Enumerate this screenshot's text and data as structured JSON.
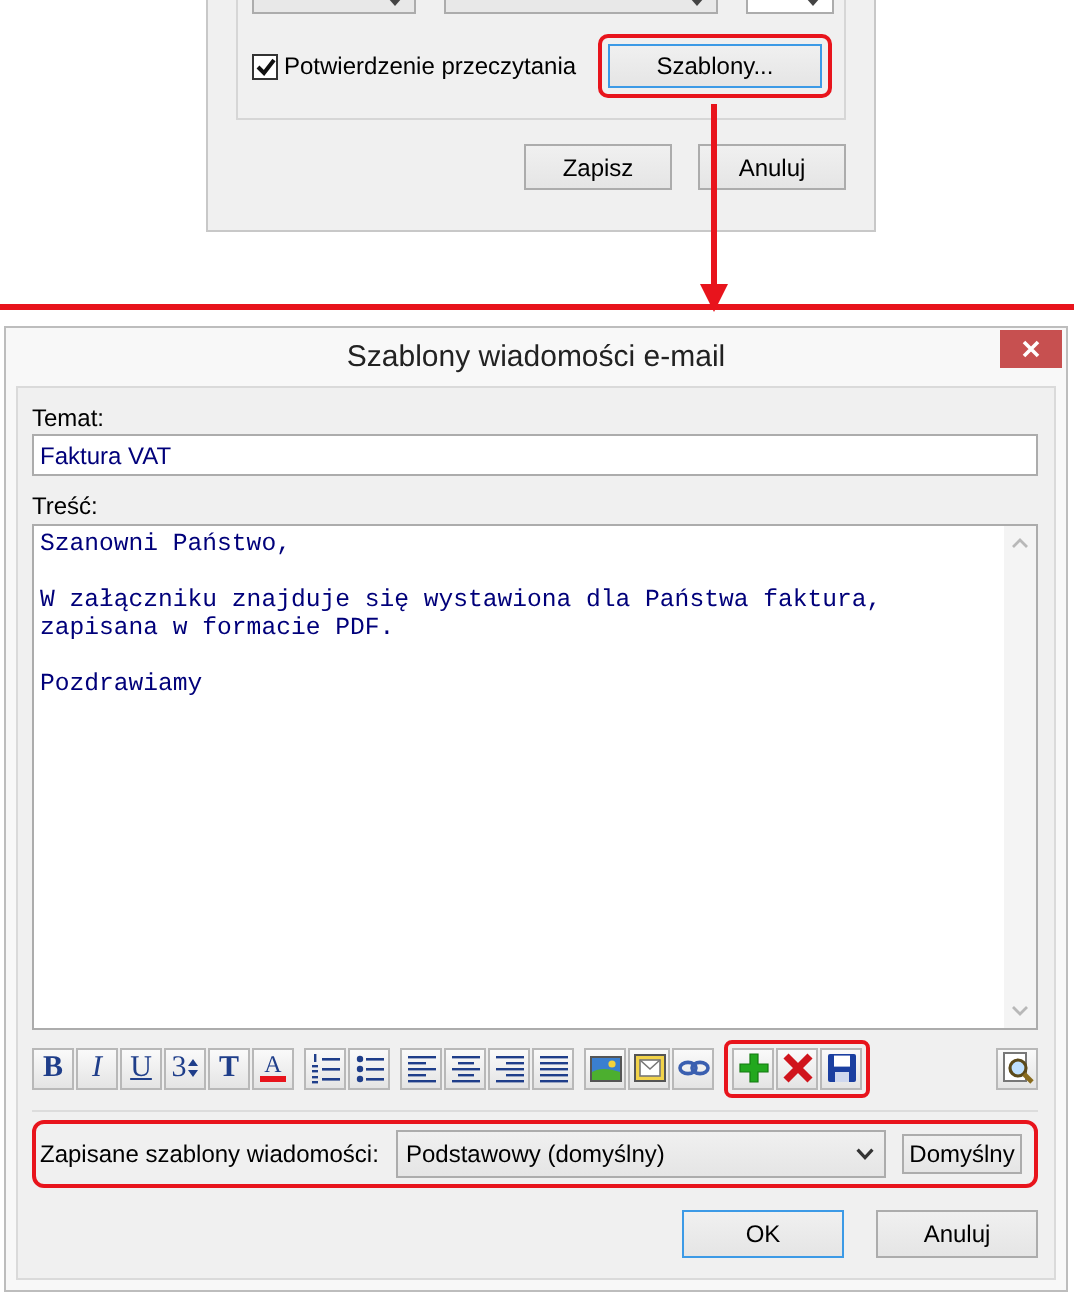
{
  "background_dialog": {
    "read_receipt": {
      "label": "Potwierdzenie przeczytania",
      "checked": true
    },
    "templates_button": {
      "label": "Szablony...",
      "focused": true,
      "highlighted": true
    },
    "buttons": [
      {
        "label": "Zapisz",
        "focused": false
      },
      {
        "label": "Anuluj",
        "focused": false
      }
    ]
  },
  "dialog": {
    "title": "Szablony wiadomości e-mail",
    "subject": {
      "label": "Temat:",
      "value": "Faktura VAT"
    },
    "body": {
      "label": "Treść:",
      "value": "Szanowni Państwo,\n\nW załączniku znajduje się wystawiona dla Państwa faktura,\nzapisana w formacie PDF.\n\nPozdrawiamy"
    },
    "toolbar": {
      "groups": [
        {
          "highlighted": false,
          "items": [
            {
              "kind": "bold",
              "label": "B"
            },
            {
              "kind": "italic",
              "label": "I"
            },
            {
              "kind": "underline",
              "label": "U"
            },
            {
              "kind": "font-size",
              "label": "3"
            },
            {
              "kind": "font",
              "label": "T"
            },
            {
              "kind": "font-color",
              "label": "A"
            }
          ]
        },
        {
          "highlighted": false,
          "items": [
            {
              "kind": "numbered-list"
            },
            {
              "kind": "bullet-list"
            }
          ]
        },
        {
          "highlighted": false,
          "items": [
            {
              "kind": "align-left"
            },
            {
              "kind": "align-center"
            },
            {
              "kind": "align-right"
            },
            {
              "kind": "justify"
            }
          ]
        },
        {
          "highlighted": false,
          "items": [
            {
              "kind": "image"
            },
            {
              "kind": "envelope"
            },
            {
              "kind": "link"
            }
          ]
        },
        {
          "highlighted": true,
          "items": [
            {
              "kind": "add"
            },
            {
              "kind": "delete"
            },
            {
              "kind": "save"
            }
          ]
        }
      ],
      "trailing_items": [
        {
          "kind": "preview"
        }
      ]
    },
    "saved_templates": {
      "label": "Zapisane szablony wiadomości:",
      "value": "Podstawowy (domyślny)",
      "highlighted": true
    },
    "default_button": {
      "label": "Domyślny"
    },
    "buttons": [
      {
        "label": "OK",
        "focused": true
      },
      {
        "label": "Anuluj",
        "focused": false
      }
    ]
  }
}
